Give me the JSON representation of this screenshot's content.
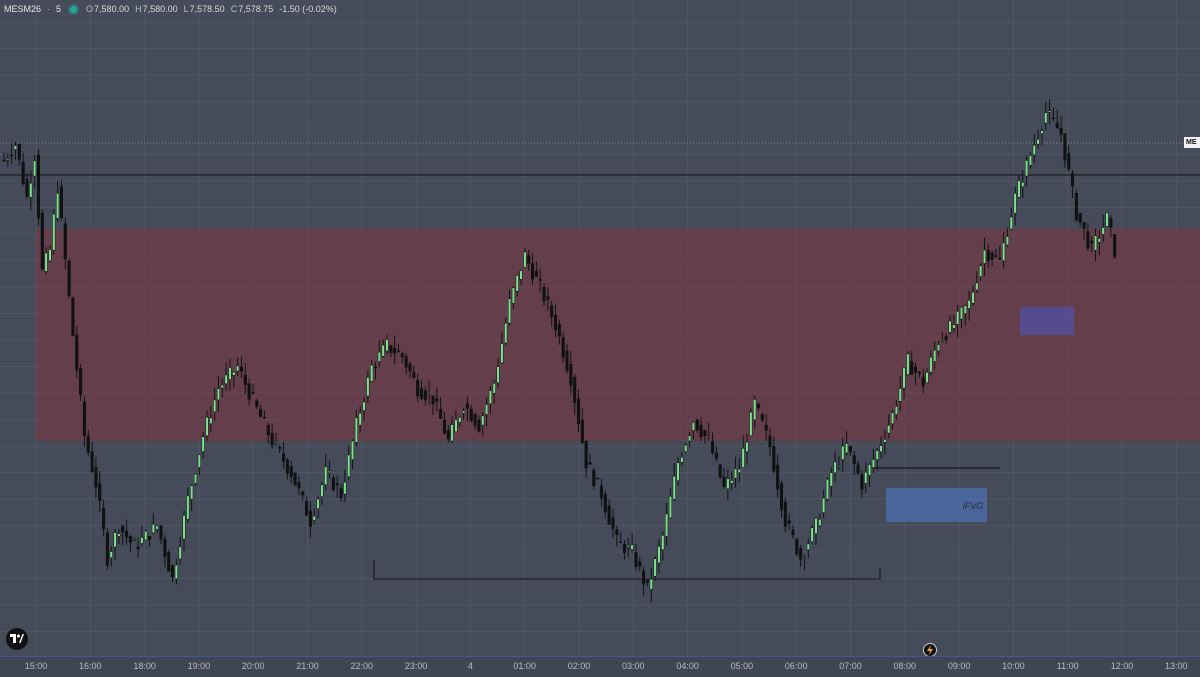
{
  "header": {
    "symbol": "MESM26",
    "interval": "5",
    "open_label": "O",
    "open": "7,580.00",
    "high_label": "H",
    "high": "7,580.00",
    "low_label": "L",
    "low": "7,578.50",
    "close_label": "C",
    "close": "7,578.75",
    "change": "-1.50 (-0.02%)",
    "status_color": "#26a69a"
  },
  "price_label": "ME",
  "colors": {
    "background": "#454b58",
    "up": "#7ee08a",
    "down": "#111111",
    "supply_zone": "#8a2f3a",
    "fvg_zone": "#4c7bd1",
    "small_zone": "#4a55c9",
    "axis_accent": "#3d59a4"
  },
  "icons": {
    "logo": "tradingview-logo-icon",
    "replay": "lightning-icon"
  },
  "annotations": {
    "fvg_label": "iFVG"
  },
  "chart_data": {
    "type": "candlestick",
    "symbol": "MESM26",
    "interval": "5",
    "x_ticks": [
      "15:00",
      "16:00",
      "18:00",
      "19:00",
      "20:00",
      "21:00",
      "22:00",
      "23:00",
      "4",
      "01:00",
      "02:00",
      "03:00",
      "04:00",
      "05:00",
      "06:00",
      "07:00",
      "08:00",
      "09:00",
      "10:00",
      "11:00",
      "12:00",
      "13:00"
    ],
    "anchors": [
      [
        0,
        0.83
      ],
      [
        3,
        0.86
      ],
      [
        6,
        0.76
      ],
      [
        8,
        0.84
      ],
      [
        10,
        0.62
      ],
      [
        12,
        0.66
      ],
      [
        14,
        0.78
      ],
      [
        18,
        0.5
      ],
      [
        21,
        0.31
      ],
      [
        24,
        0.22
      ],
      [
        27,
        0.08
      ],
      [
        30,
        0.14
      ],
      [
        34,
        0.1
      ],
      [
        40,
        0.14
      ],
      [
        44,
        0.04
      ],
      [
        48,
        0.19
      ],
      [
        52,
        0.31
      ],
      [
        56,
        0.4
      ],
      [
        61,
        0.44
      ],
      [
        66,
        0.36
      ],
      [
        70,
        0.3
      ],
      [
        75,
        0.24
      ],
      [
        80,
        0.15
      ],
      [
        84,
        0.24
      ],
      [
        88,
        0.2
      ],
      [
        92,
        0.33
      ],
      [
        96,
        0.44
      ],
      [
        100,
        0.48
      ],
      [
        104,
        0.46
      ],
      [
        108,
        0.4
      ],
      [
        112,
        0.38
      ],
      [
        116,
        0.3
      ],
      [
        120,
        0.37
      ],
      [
        124,
        0.33
      ],
      [
        128,
        0.41
      ],
      [
        132,
        0.56
      ],
      [
        136,
        0.65
      ],
      [
        140,
        0.59
      ],
      [
        144,
        0.52
      ],
      [
        148,
        0.42
      ],
      [
        152,
        0.26
      ],
      [
        156,
        0.2
      ],
      [
        160,
        0.11
      ],
      [
        164,
        0.09
      ],
      [
        168,
        0.02
      ],
      [
        172,
        0.12
      ],
      [
        176,
        0.26
      ],
      [
        180,
        0.34
      ],
      [
        184,
        0.3
      ],
      [
        188,
        0.21
      ],
      [
        192,
        0.25
      ],
      [
        196,
        0.37
      ],
      [
        200,
        0.29
      ],
      [
        204,
        0.15
      ],
      [
        208,
        0.08
      ],
      [
        212,
        0.14
      ],
      [
        216,
        0.24
      ],
      [
        220,
        0.29
      ],
      [
        224,
        0.22
      ],
      [
        228,
        0.28
      ],
      [
        232,
        0.35
      ],
      [
        236,
        0.45
      ],
      [
        240,
        0.41
      ],
      [
        244,
        0.49
      ],
      [
        248,
        0.52
      ],
      [
        252,
        0.56
      ],
      [
        256,
        0.66
      ],
      [
        260,
        0.64
      ],
      [
        264,
        0.76
      ],
      [
        268,
        0.84
      ],
      [
        272,
        0.92
      ],
      [
        276,
        0.88
      ],
      [
        280,
        0.73
      ],
      [
        284,
        0.66
      ],
      [
        288,
        0.72
      ],
      [
        290,
        0.66
      ]
    ]
  }
}
